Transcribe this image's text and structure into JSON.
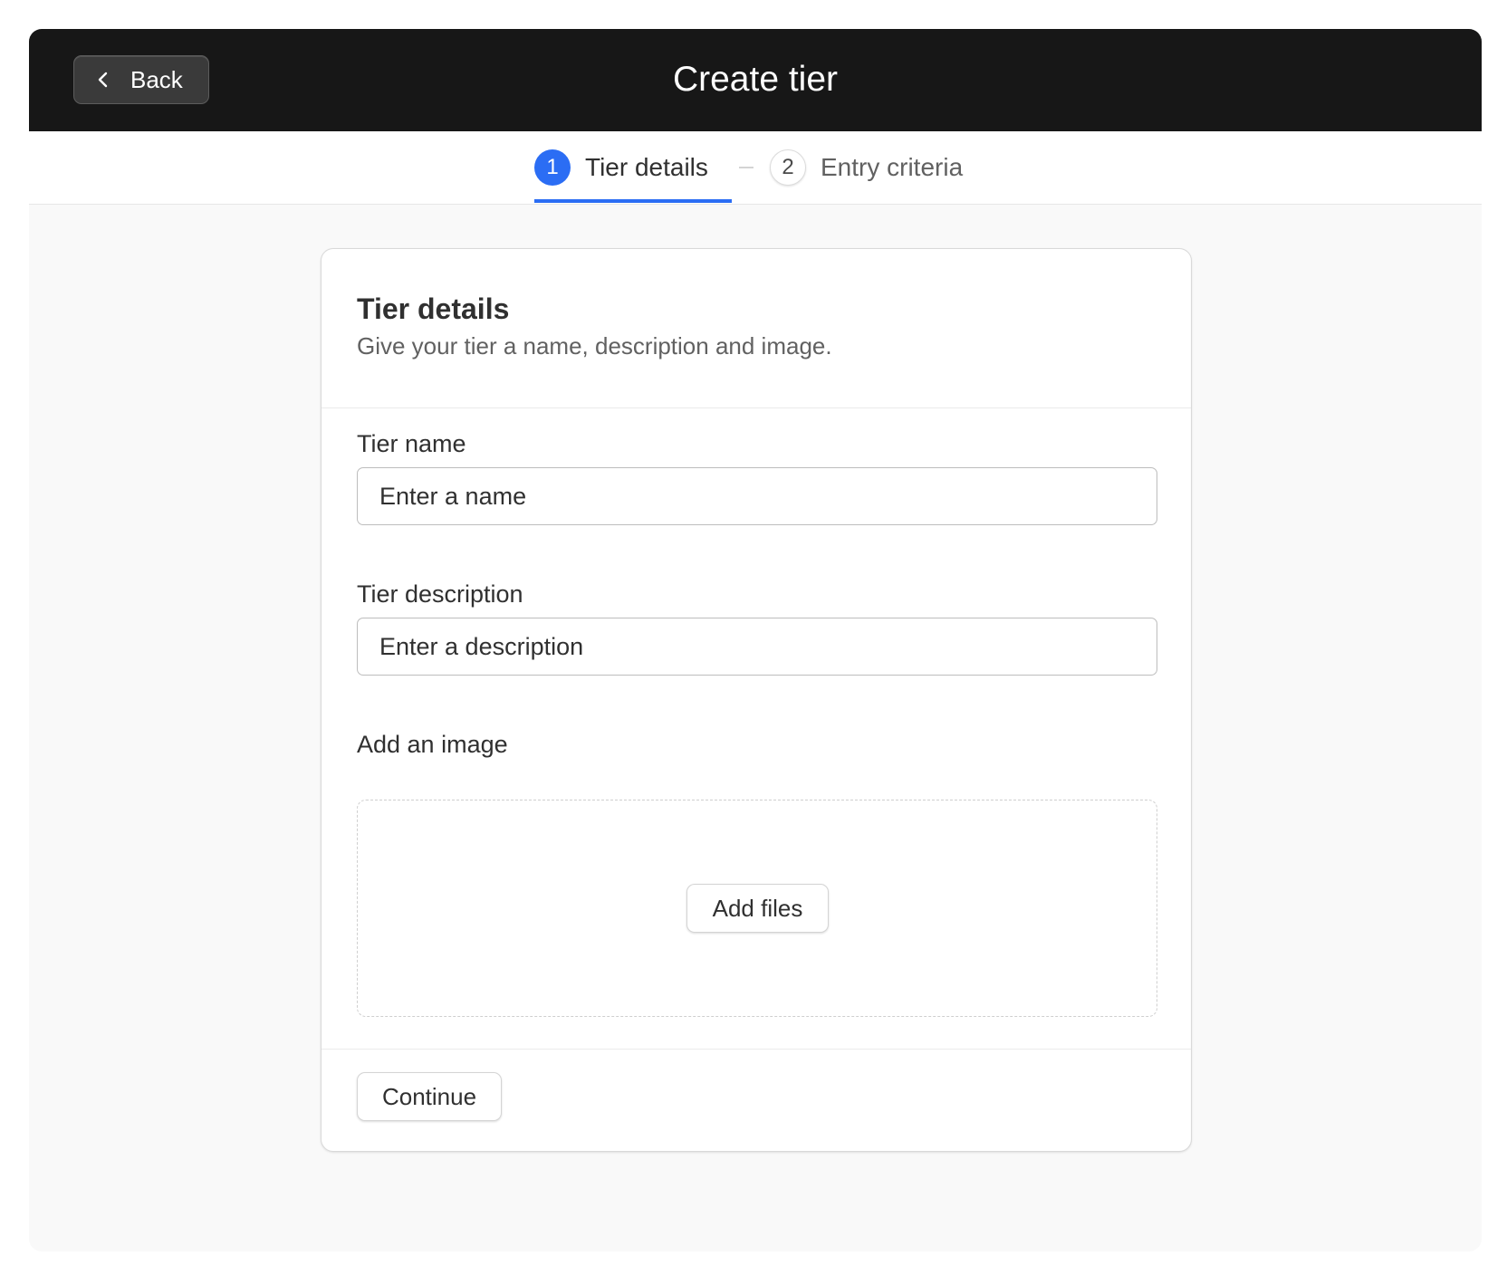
{
  "header": {
    "back_label": "Back",
    "title": "Create tier"
  },
  "stepper": {
    "steps": [
      {
        "number": "1",
        "label": "Tier details",
        "active": true
      },
      {
        "number": "2",
        "label": "Entry criteria",
        "active": false
      }
    ],
    "accent_color": "#2b6df4"
  },
  "card": {
    "title": "Tier details",
    "subtitle": "Give your tier a name, description and image.",
    "fields": {
      "name": {
        "label": "Tier name",
        "value": "",
        "placeholder": "Enter a name"
      },
      "description": {
        "label": "Tier description",
        "value": "",
        "placeholder": "Enter a description"
      },
      "image": {
        "label": "Add an image",
        "button_label": "Add files"
      }
    },
    "continue_label": "Continue"
  },
  "icons": {
    "back": "chevron-left-icon"
  }
}
